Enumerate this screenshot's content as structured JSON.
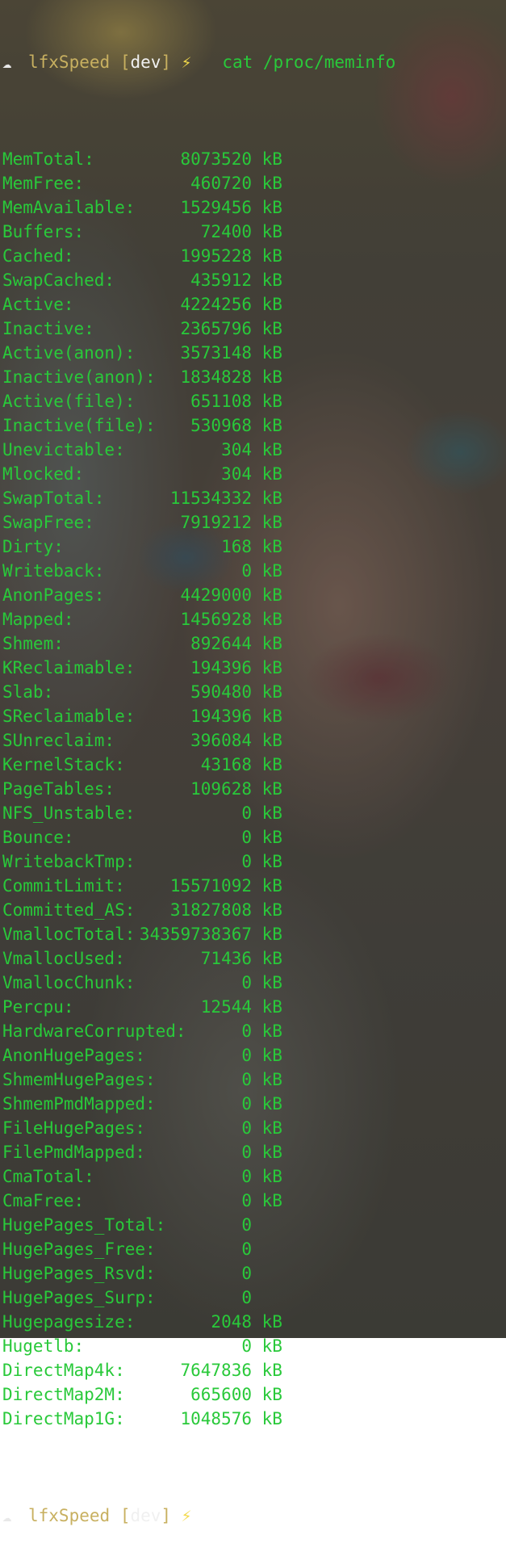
{
  "prompt": {
    "icon": "cloud-icon",
    "host": "lfxSpeed",
    "branch": "dev",
    "bolt": "⚡",
    "command": "cat /proc/meminfo"
  },
  "meminfo": [
    {
      "key": "MemTotal:",
      "value": "8073520",
      "unit": "kB"
    },
    {
      "key": "MemFree:",
      "value": "460720",
      "unit": "kB"
    },
    {
      "key": "MemAvailable:",
      "value": "1529456",
      "unit": "kB"
    },
    {
      "key": "Buffers:",
      "value": "72400",
      "unit": "kB"
    },
    {
      "key": "Cached:",
      "value": "1995228",
      "unit": "kB"
    },
    {
      "key": "SwapCached:",
      "value": "435912",
      "unit": "kB"
    },
    {
      "key": "Active:",
      "value": "4224256",
      "unit": "kB"
    },
    {
      "key": "Inactive:",
      "value": "2365796",
      "unit": "kB"
    },
    {
      "key": "Active(anon):",
      "value": "3573148",
      "unit": "kB"
    },
    {
      "key": "Inactive(anon):",
      "value": "1834828",
      "unit": "kB"
    },
    {
      "key": "Active(file):",
      "value": "651108",
      "unit": "kB"
    },
    {
      "key": "Inactive(file):",
      "value": "530968",
      "unit": "kB"
    },
    {
      "key": "Unevictable:",
      "value": "304",
      "unit": "kB"
    },
    {
      "key": "Mlocked:",
      "value": "304",
      "unit": "kB"
    },
    {
      "key": "SwapTotal:",
      "value": "11534332",
      "unit": "kB"
    },
    {
      "key": "SwapFree:",
      "value": "7919212",
      "unit": "kB"
    },
    {
      "key": "Dirty:",
      "value": "168",
      "unit": "kB"
    },
    {
      "key": "Writeback:",
      "value": "0",
      "unit": "kB"
    },
    {
      "key": "AnonPages:",
      "value": "4429000",
      "unit": "kB"
    },
    {
      "key": "Mapped:",
      "value": "1456928",
      "unit": "kB"
    },
    {
      "key": "Shmem:",
      "value": "892644",
      "unit": "kB"
    },
    {
      "key": "KReclaimable:",
      "value": "194396",
      "unit": "kB"
    },
    {
      "key": "Slab:",
      "value": "590480",
      "unit": "kB"
    },
    {
      "key": "SReclaimable:",
      "value": "194396",
      "unit": "kB"
    },
    {
      "key": "SUnreclaim:",
      "value": "396084",
      "unit": "kB"
    },
    {
      "key": "KernelStack:",
      "value": "43168",
      "unit": "kB"
    },
    {
      "key": "PageTables:",
      "value": "109628",
      "unit": "kB"
    },
    {
      "key": "NFS_Unstable:",
      "value": "0",
      "unit": "kB"
    },
    {
      "key": "Bounce:",
      "value": "0",
      "unit": "kB"
    },
    {
      "key": "WritebackTmp:",
      "value": "0",
      "unit": "kB"
    },
    {
      "key": "CommitLimit:",
      "value": "15571092",
      "unit": "kB"
    },
    {
      "key": "Committed_AS:",
      "value": "31827808",
      "unit": "kB"
    },
    {
      "key": "VmallocTotal:",
      "value": "34359738367",
      "unit": "kB"
    },
    {
      "key": "VmallocUsed:",
      "value": "71436",
      "unit": "kB"
    },
    {
      "key": "VmallocChunk:",
      "value": "0",
      "unit": "kB"
    },
    {
      "key": "Percpu:",
      "value": "12544",
      "unit": "kB"
    },
    {
      "key": "HardwareCorrupted:",
      "value": "0",
      "unit": "kB"
    },
    {
      "key": "AnonHugePages:",
      "value": "0",
      "unit": "kB"
    },
    {
      "key": "ShmemHugePages:",
      "value": "0",
      "unit": "kB"
    },
    {
      "key": "ShmemPmdMapped:",
      "value": "0",
      "unit": "kB"
    },
    {
      "key": "FileHugePages:",
      "value": "0",
      "unit": "kB"
    },
    {
      "key": "FilePmdMapped:",
      "value": "0",
      "unit": "kB"
    },
    {
      "key": "CmaTotal:",
      "value": "0",
      "unit": "kB"
    },
    {
      "key": "CmaFree:",
      "value": "0",
      "unit": "kB"
    },
    {
      "key": "HugePages_Total:",
      "value": "0",
      "unit": ""
    },
    {
      "key": "HugePages_Free:",
      "value": "0",
      "unit": ""
    },
    {
      "key": "HugePages_Rsvd:",
      "value": "0",
      "unit": ""
    },
    {
      "key": "HugePages_Surp:",
      "value": "0",
      "unit": ""
    },
    {
      "key": "Hugepagesize:",
      "value": "2048",
      "unit": "kB"
    },
    {
      "key": "Hugetlb:",
      "value": "0",
      "unit": "kB"
    },
    {
      "key": "DirectMap4k:",
      "value": "7647836",
      "unit": "kB"
    },
    {
      "key": "DirectMap2M:",
      "value": "665600",
      "unit": "kB"
    },
    {
      "key": "DirectMap1G:",
      "value": "1048576",
      "unit": "kB"
    }
  ],
  "final_prompt": {
    "icon": "cloud-icon",
    "host": "lfxSpeed",
    "branch": "dev",
    "bolt": "⚡"
  }
}
